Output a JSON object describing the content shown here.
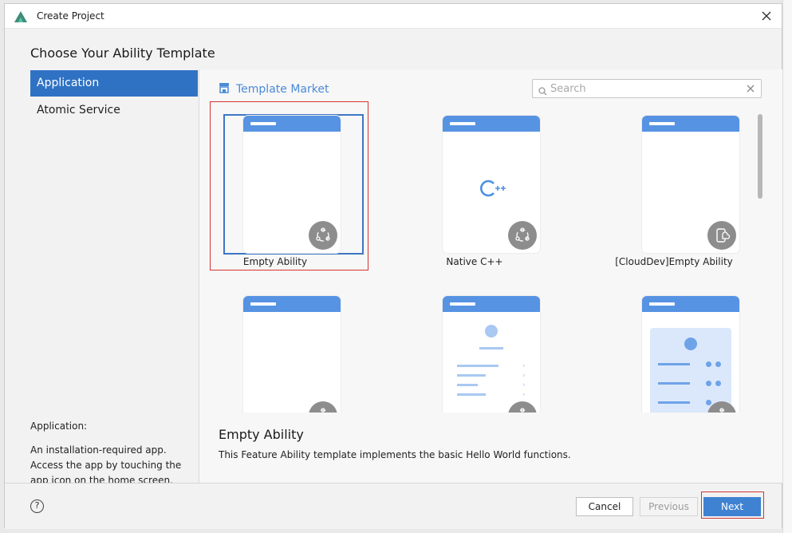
{
  "window": {
    "title": "Create Project"
  },
  "heading": "Choose Your Ability Template",
  "sidebar": {
    "items": [
      {
        "label": "Application",
        "active": true
      },
      {
        "label": "Atomic Service",
        "active": false
      }
    ],
    "description_title": "Application:",
    "description_text": "An installation-required app. Access the app by touching the app icon on the home screen."
  },
  "market": {
    "label": "Template Market"
  },
  "search": {
    "placeholder": "Search",
    "value": ""
  },
  "templates": [
    {
      "label": "Empty Ability",
      "selected": true,
      "badge_icon": "ability-icon"
    },
    {
      "label": "Native C++",
      "selected": false,
      "badge_icon": "ability-icon",
      "preview_text": "C++"
    },
    {
      "label": "[CloudDev]Empty Ability",
      "selected": false,
      "badge_icon": "cloud-device-icon"
    },
    {
      "label": "",
      "selected": false,
      "badge_icon": "ability-icon"
    },
    {
      "label": "",
      "selected": false,
      "badge_icon": "ability-icon"
    },
    {
      "label": "",
      "selected": false,
      "badge_icon": "ability-icon"
    }
  ],
  "detail": {
    "title": "Empty Ability",
    "text": "This Feature Ability template implements the basic Hello World functions."
  },
  "footer": {
    "help": "?",
    "cancel": "Cancel",
    "previous": "Previous",
    "next": "Next"
  },
  "colors": {
    "accent": "#2f72c4",
    "header_blue": "#5793e3",
    "highlight_red": "#d53333",
    "next_button": "#3f82d2"
  }
}
